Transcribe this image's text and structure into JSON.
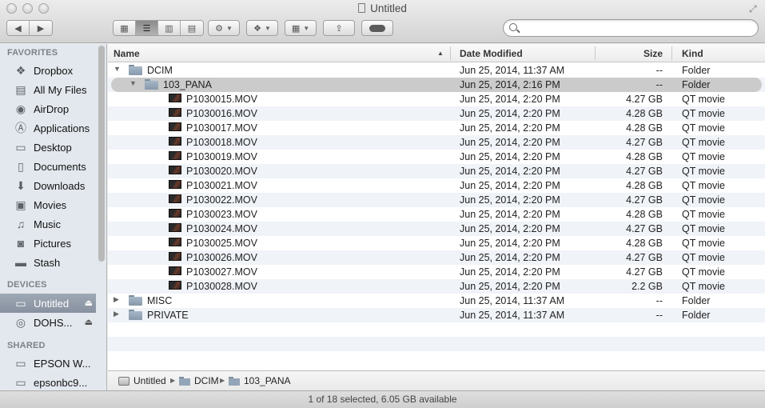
{
  "window": {
    "title": "Untitled"
  },
  "toolbar": {
    "back_icon": "chevron-left",
    "forward_icon": "chevron-right",
    "view_icons": [
      "icon-view",
      "list-view",
      "column-view",
      "coverflow-view"
    ],
    "active_view": "list-view",
    "action_icon": "gear",
    "dropbox_icon": "dropbox",
    "arrange_icon": "arrange-grid",
    "share_icon": "share",
    "tag_icon": "tag-pill"
  },
  "search": {
    "value": "",
    "placeholder": ""
  },
  "sidebar": {
    "favorites_header": "FAVORITES",
    "favorites": [
      {
        "label": "Dropbox",
        "icon": "dropbox-icon"
      },
      {
        "label": "All My Files",
        "icon": "all-files-icon"
      },
      {
        "label": "AirDrop",
        "icon": "airdrop-icon"
      },
      {
        "label": "Applications",
        "icon": "applications-icon"
      },
      {
        "label": "Desktop",
        "icon": "desktop-icon"
      },
      {
        "label": "Documents",
        "icon": "documents-icon"
      },
      {
        "label": "Downloads",
        "icon": "downloads-icon"
      },
      {
        "label": "Movies",
        "icon": "movies-icon"
      },
      {
        "label": "Music",
        "icon": "music-icon"
      },
      {
        "label": "Pictures",
        "icon": "pictures-icon"
      },
      {
        "label": "Stash",
        "icon": "folder-icon"
      }
    ],
    "devices_header": "DEVICES",
    "devices": [
      {
        "label": "Untitled",
        "icon": "drive-icon",
        "selected": true
      },
      {
        "label": "DOHS...",
        "icon": "disk-icon",
        "selected": false
      }
    ],
    "shared_header": "SHARED",
    "shared": [
      {
        "label": "EPSON W...",
        "icon": "monitor-icon"
      },
      {
        "label": "epsonbc9...",
        "icon": "monitor-icon"
      }
    ]
  },
  "columns": {
    "name": "Name",
    "date": "Date Modified",
    "size": "Size",
    "kind": "Kind"
  },
  "rows": [
    {
      "name": "DCIM",
      "date": "Jun 25, 2014, 11:37 AM",
      "size": "--",
      "kind": "Folder",
      "type": "folder",
      "level": 0,
      "expanded": true,
      "selected": false
    },
    {
      "name": "103_PANA",
      "date": "Jun 25, 2014, 2:16 PM",
      "size": "--",
      "kind": "Folder",
      "type": "folder",
      "level": 1,
      "expanded": true,
      "selected": true
    },
    {
      "name": "P1030015.MOV",
      "date": "Jun 25, 2014, 2:20 PM",
      "size": "4.27 GB",
      "kind": "QT movie",
      "type": "movie",
      "level": 2
    },
    {
      "name": "P1030016.MOV",
      "date": "Jun 25, 2014, 2:20 PM",
      "size": "4.28 GB",
      "kind": "QT movie",
      "type": "movie",
      "level": 2
    },
    {
      "name": "P1030017.MOV",
      "date": "Jun 25, 2014, 2:20 PM",
      "size": "4.28 GB",
      "kind": "QT movie",
      "type": "movie",
      "level": 2
    },
    {
      "name": "P1030018.MOV",
      "date": "Jun 25, 2014, 2:20 PM",
      "size": "4.27 GB",
      "kind": "QT movie",
      "type": "movie",
      "level": 2
    },
    {
      "name": "P1030019.MOV",
      "date": "Jun 25, 2014, 2:20 PM",
      "size": "4.28 GB",
      "kind": "QT movie",
      "type": "movie",
      "level": 2
    },
    {
      "name": "P1030020.MOV",
      "date": "Jun 25, 2014, 2:20 PM",
      "size": "4.27 GB",
      "kind": "QT movie",
      "type": "movie",
      "level": 2
    },
    {
      "name": "P1030021.MOV",
      "date": "Jun 25, 2014, 2:20 PM",
      "size": "4.28 GB",
      "kind": "QT movie",
      "type": "movie",
      "level": 2
    },
    {
      "name": "P1030022.MOV",
      "date": "Jun 25, 2014, 2:20 PM",
      "size": "4.27 GB",
      "kind": "QT movie",
      "type": "movie",
      "level": 2
    },
    {
      "name": "P1030023.MOV",
      "date": "Jun 25, 2014, 2:20 PM",
      "size": "4.28 GB",
      "kind": "QT movie",
      "type": "movie",
      "level": 2
    },
    {
      "name": "P1030024.MOV",
      "date": "Jun 25, 2014, 2:20 PM",
      "size": "4.27 GB",
      "kind": "QT movie",
      "type": "movie",
      "level": 2
    },
    {
      "name": "P1030025.MOV",
      "date": "Jun 25, 2014, 2:20 PM",
      "size": "4.28 GB",
      "kind": "QT movie",
      "type": "movie",
      "level": 2
    },
    {
      "name": "P1030026.MOV",
      "date": "Jun 25, 2014, 2:20 PM",
      "size": "4.27 GB",
      "kind": "QT movie",
      "type": "movie",
      "level": 2
    },
    {
      "name": "P1030027.MOV",
      "date": "Jun 25, 2014, 2:20 PM",
      "size": "4.27 GB",
      "kind": "QT movie",
      "type": "movie",
      "level": 2
    },
    {
      "name": "P1030028.MOV",
      "date": "Jun 25, 2014, 2:20 PM",
      "size": "2.2 GB",
      "kind": "QT movie",
      "type": "movie",
      "level": 2
    },
    {
      "name": "MISC",
      "date": "Jun 25, 2014, 11:37 AM",
      "size": "--",
      "kind": "Folder",
      "type": "folder",
      "level": 0,
      "expanded": false
    },
    {
      "name": "PRIVATE",
      "date": "Jun 25, 2014, 11:37 AM",
      "size": "--",
      "kind": "Folder",
      "type": "folder",
      "level": 0,
      "expanded": false
    }
  ],
  "pathbar": [
    "Untitled",
    "DCIM",
    "103_PANA"
  ],
  "status": {
    "text": "1 of 18 selected, 6.05 GB available"
  },
  "colors": {
    "selection": "#cbcbcb",
    "sidebar_selected": "#8f99a6",
    "alt_row": "#f0f3f8",
    "folder": "#93a5b7"
  }
}
